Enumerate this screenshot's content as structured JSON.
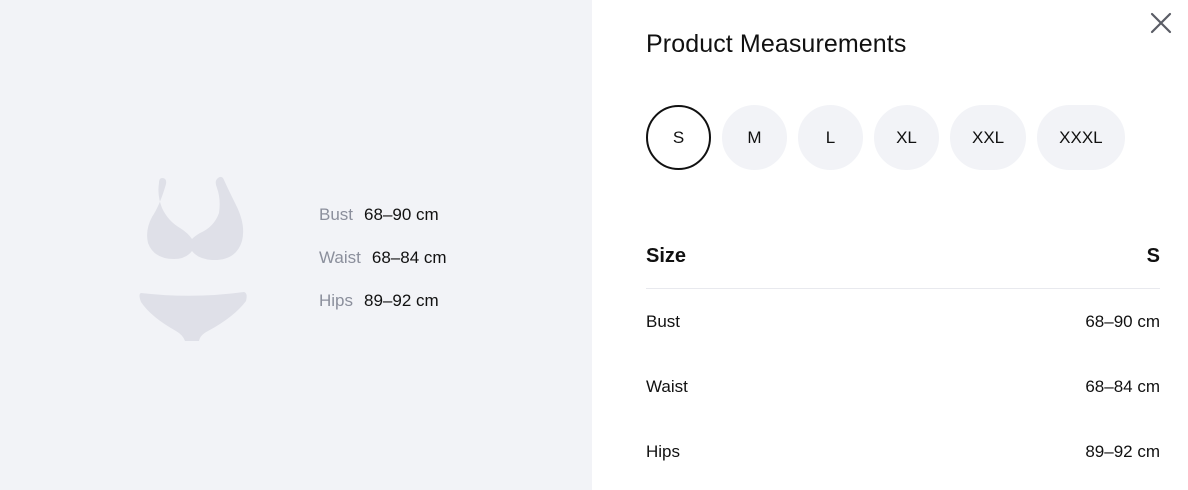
{
  "illustration": {
    "icon": "swimsuit-icon",
    "measurements": [
      {
        "label": "Bust",
        "value": "68–90 cm"
      },
      {
        "label": "Waist",
        "value": "68–84 cm"
      },
      {
        "label": "Hips",
        "value": "89–92 cm"
      }
    ]
  },
  "panel": {
    "title": "Product Measurements",
    "close_icon": "close-icon",
    "sizes": [
      "S",
      "M",
      "L",
      "XL",
      "XXL",
      "XXXL"
    ],
    "selected_size": "S",
    "table": {
      "header_label": "Size",
      "header_value": "S",
      "rows": [
        {
          "label": "Bust",
          "value": "68–90 cm"
        },
        {
          "label": "Waist",
          "value": "68–84 cm"
        },
        {
          "label": "Hips",
          "value": "89–92 cm"
        }
      ]
    }
  },
  "colors": {
    "panel_bg": "#f2f3f7",
    "muted_text": "#8b8f9c",
    "illustration_fill": "#dfe0e8",
    "selected_border": "#111111"
  }
}
